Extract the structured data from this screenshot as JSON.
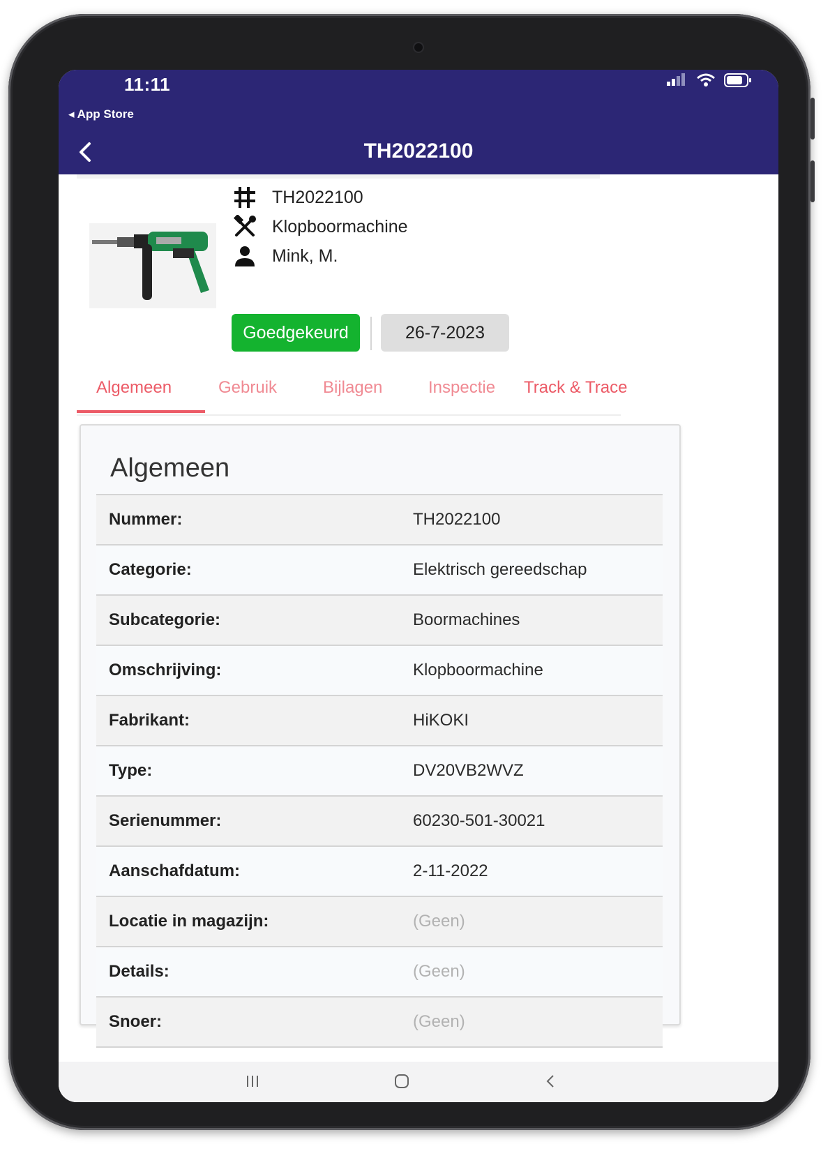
{
  "status_bar": {
    "time": "11:11"
  },
  "app_store_back": "◂ App Store",
  "header": {
    "title": "TH2022100"
  },
  "item": {
    "number": "TH2022100",
    "description": "Klopboormachine",
    "owner": "Mink, M.",
    "status": "Goedgekeurd",
    "date": "26-7-2023"
  },
  "tabs": [
    {
      "label": "Algemeen",
      "active": true
    },
    {
      "label": "Gebruik",
      "active": false
    },
    {
      "label": "Bijlagen",
      "active": false
    },
    {
      "label": "Inspectie",
      "active": false
    },
    {
      "label": "Track & Trace",
      "active": false
    }
  ],
  "card": {
    "title": "Algemeen",
    "rows": [
      {
        "label": "Nummer:",
        "value": "TH2022100"
      },
      {
        "label": "Categorie:",
        "value": "Elektrisch gereedschap"
      },
      {
        "label": "Subcategorie:",
        "value": "Boormachines"
      },
      {
        "label": "Omschrijving:",
        "value": "Klopboormachine"
      },
      {
        "label": "Fabrikant:",
        "value": "HiKOKI"
      },
      {
        "label": "Type:",
        "value": "DV20VB2WVZ"
      },
      {
        "label": "Serienummer:",
        "value": "60230-501-30021"
      },
      {
        "label": "Aanschafdatum:",
        "value": "2-11-2022"
      },
      {
        "label": "Locatie in magazijn:",
        "value": "(Geen)"
      },
      {
        "label": "Details:",
        "value": "(Geen)"
      },
      {
        "label": "Snoer:",
        "value": "(Geen)"
      }
    ]
  },
  "colors": {
    "header_bg": "#2c2675",
    "accent_tab": "#ec5b67",
    "status_green": "#14b32f"
  },
  "icons": [
    "back-chevron-icon",
    "hashtag-icon",
    "tools-icon",
    "person-icon",
    "signal-icon",
    "wifi-icon",
    "battery-icon",
    "drill-image",
    "recent-apps-icon",
    "home-icon",
    "back-nav-icon"
  ]
}
